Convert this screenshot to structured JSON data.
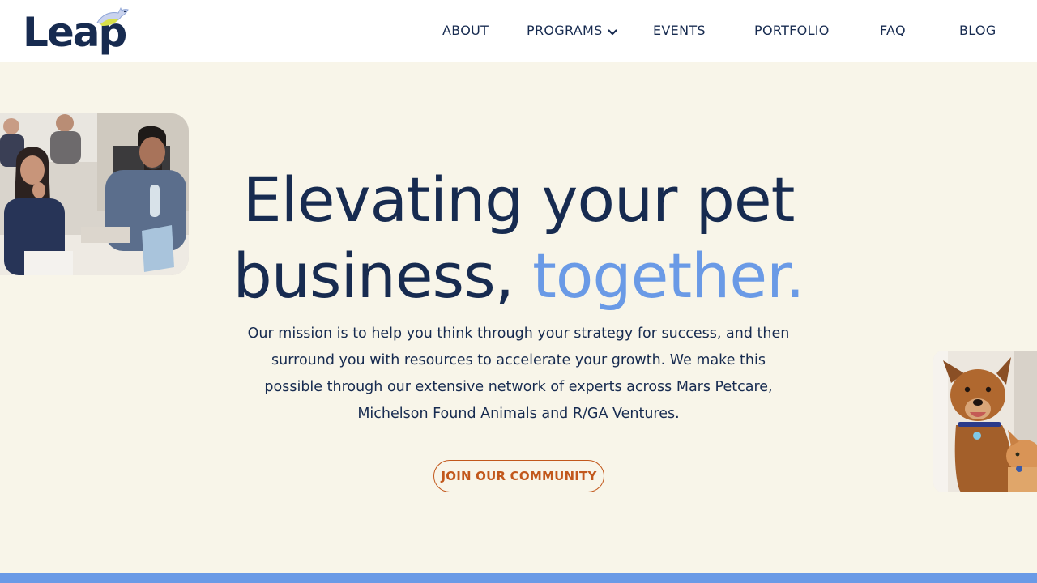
{
  "brand": {
    "name": "Leap"
  },
  "nav": {
    "items": [
      {
        "label": "ABOUT"
      },
      {
        "label": "PROGRAMS"
      },
      {
        "label": "EVENTS"
      },
      {
        "label": "PORTFOLIO"
      },
      {
        "label": "FAQ"
      },
      {
        "label": "BLOG"
      }
    ]
  },
  "hero": {
    "headline_line1": "Elevating your pet",
    "headline_line2_main": "business,",
    "headline_line2_accent": "together.",
    "mission": "Our mission is to help you think through your strategy for success, and then surround you with resources to accelerate your growth. We make this possible through our extensive network of experts across Mars Petcare, Michelson Found Animals and R/GA Ventures.",
    "cta_label": "JOIN OUR COMMUNITY"
  },
  "colors": {
    "navy": "#172b50",
    "accent_blue": "#6a9ae6",
    "cta_orange": "#c2581c",
    "background_cream": "#f8f5e9"
  },
  "icons": {
    "programs_dropdown": "chevron-down-icon",
    "logo_mark": "leaping-pet-icon"
  }
}
